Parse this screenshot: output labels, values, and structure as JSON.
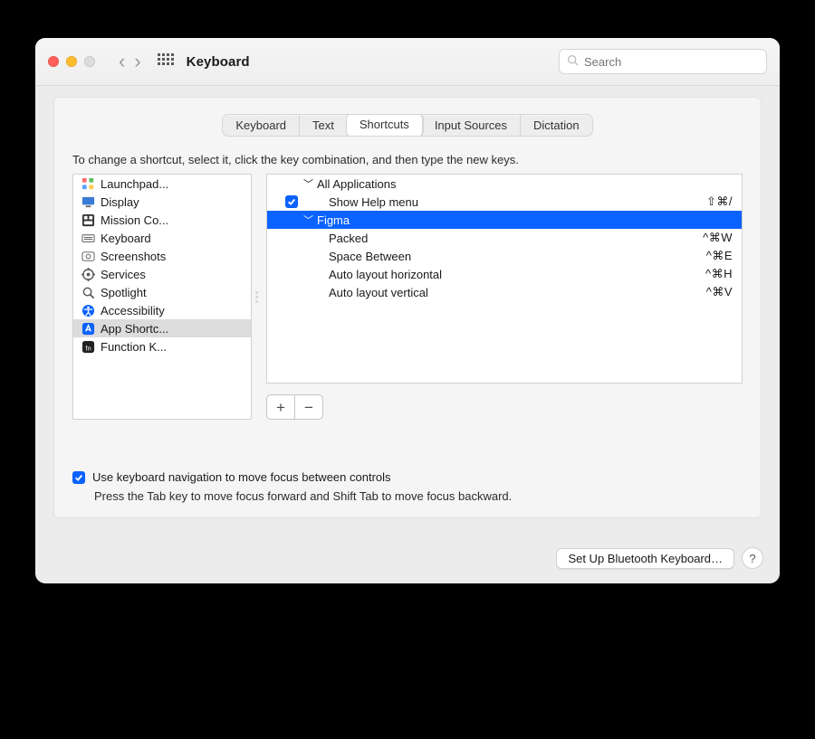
{
  "window": {
    "title": "Keyboard"
  },
  "search": {
    "placeholder": "Search"
  },
  "tabs": {
    "items": [
      "Keyboard",
      "Text",
      "Shortcuts",
      "Input Sources",
      "Dictation"
    ],
    "active_index": 2
  },
  "instructions": "To change a shortcut, select it, click the key combination, and then type the new keys.",
  "sidebar": {
    "selected_index": 8,
    "items": [
      {
        "label": "Launchpad...",
        "icon": "launchpad"
      },
      {
        "label": "Display",
        "icon": "display"
      },
      {
        "label": "Mission Co...",
        "icon": "mission-control"
      },
      {
        "label": "Keyboard",
        "icon": "keyboard"
      },
      {
        "label": "Screenshots",
        "icon": "screenshots"
      },
      {
        "label": "Services",
        "icon": "services"
      },
      {
        "label": "Spotlight",
        "icon": "spotlight"
      },
      {
        "label": "Accessibility",
        "icon": "accessibility"
      },
      {
        "label": "App Shortc...",
        "icon": "app-shortcuts"
      },
      {
        "label": "Function K...",
        "icon": "function-keys"
      }
    ]
  },
  "tree": {
    "rows": [
      {
        "kind": "group",
        "label": "All Applications",
        "expanded": true
      },
      {
        "kind": "item",
        "label": "Show Help menu",
        "accel": "⇧⌘/",
        "checked": true
      },
      {
        "kind": "group",
        "label": "Figma",
        "expanded": true,
        "selected": true
      },
      {
        "kind": "item",
        "label": "Packed",
        "accel": "^⌘W"
      },
      {
        "kind": "item",
        "label": "Space Between",
        "accel": "^⌘E"
      },
      {
        "kind": "item",
        "label": "Auto layout horizontal",
        "accel": "^⌘H"
      },
      {
        "kind": "item",
        "label": "Auto layout vertical",
        "accel": "^⌘V"
      }
    ]
  },
  "buttons": {
    "add": "+",
    "remove": "−"
  },
  "kb_nav": {
    "checked": true,
    "label": "Use keyboard navigation to move focus between controls",
    "hint": "Press the Tab key to move focus forward and Shift Tab to move focus backward."
  },
  "footer": {
    "bluetooth": "Set Up Bluetooth Keyboard…",
    "help": "?"
  }
}
